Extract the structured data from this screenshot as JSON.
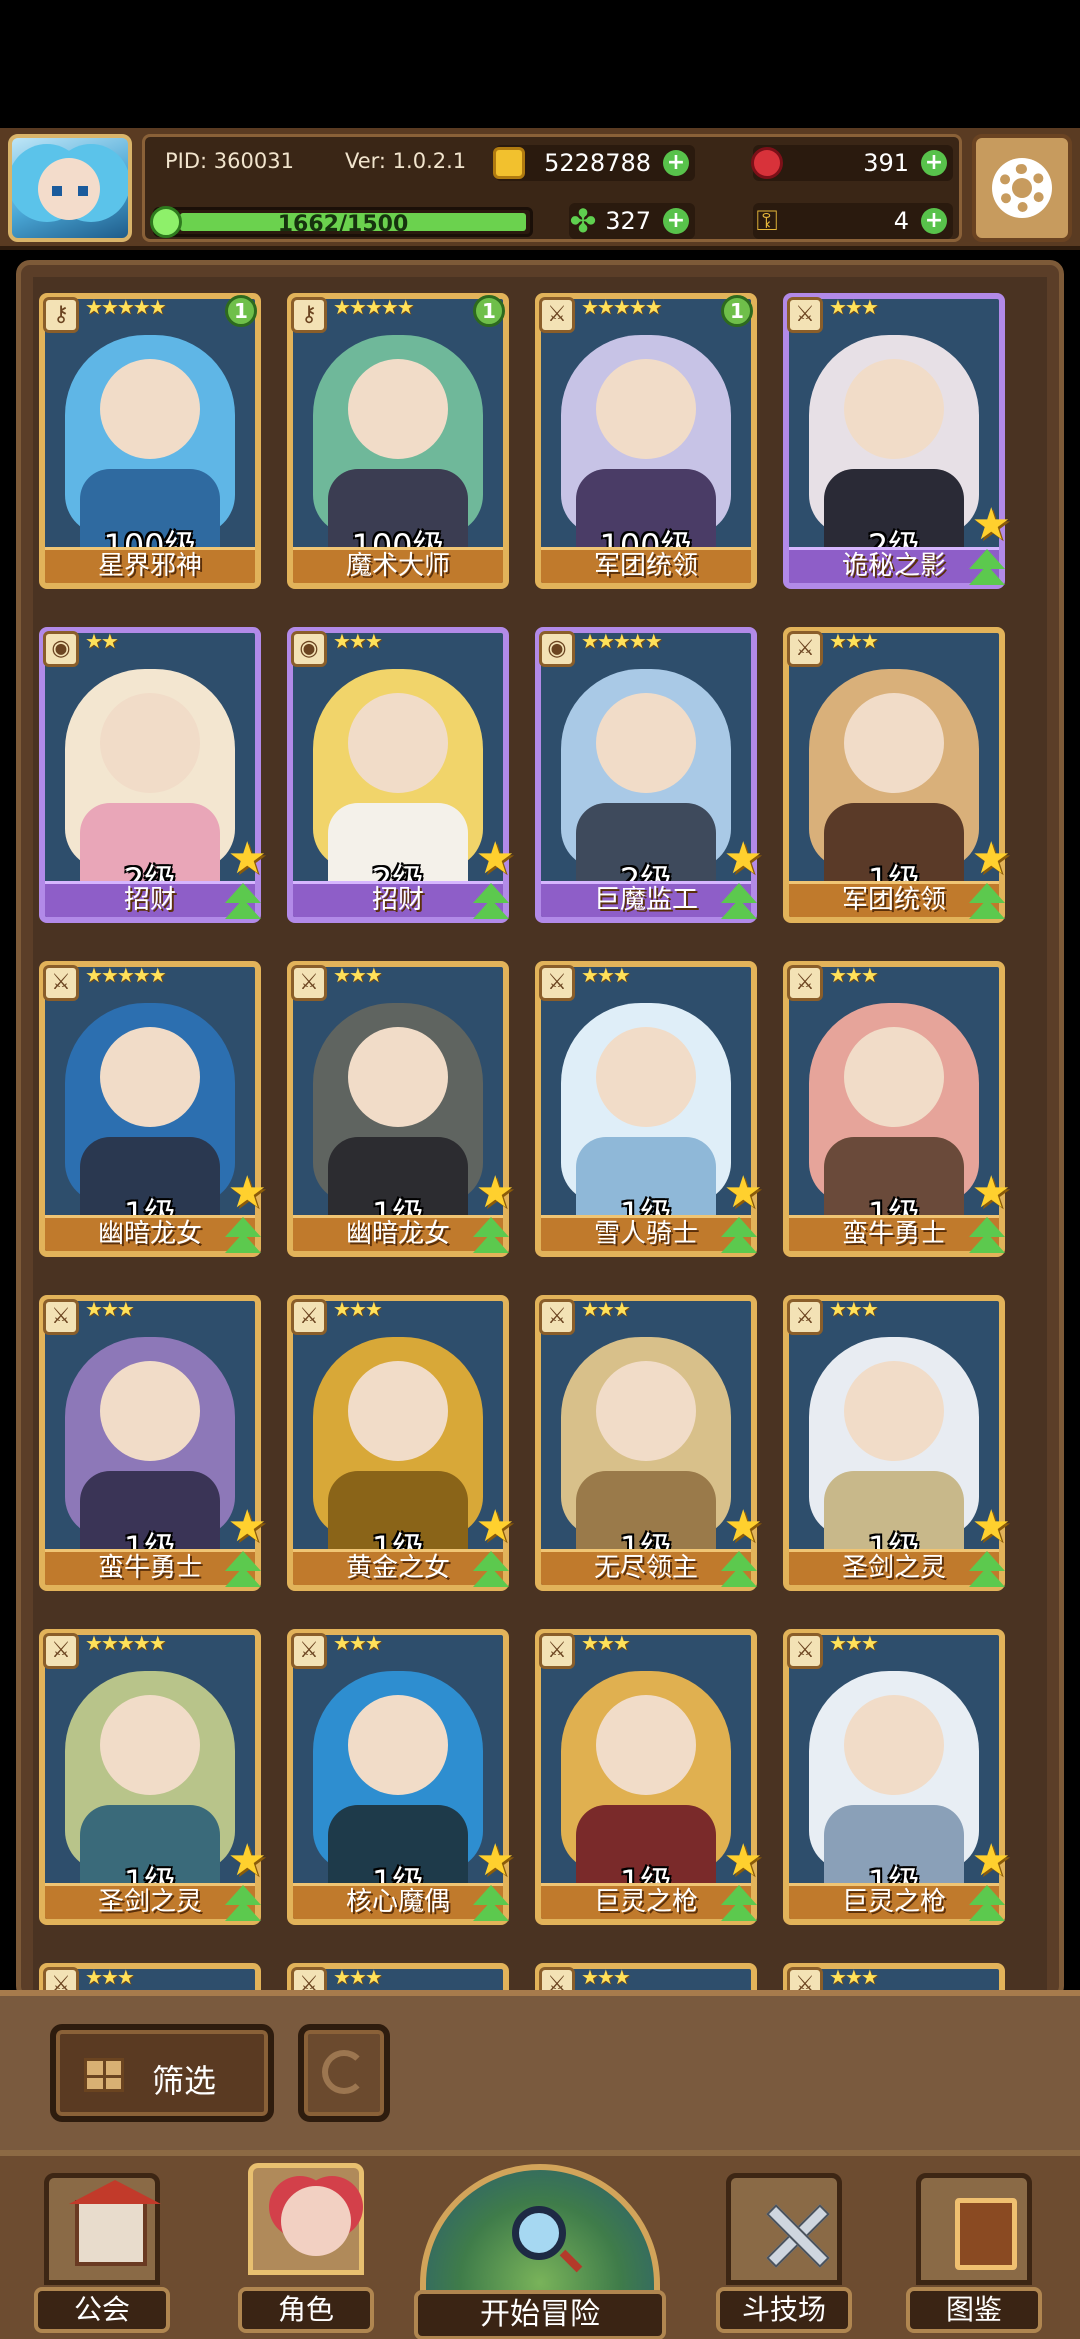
{
  "header": {
    "pid": "PID: 360031",
    "version": "Ver: 1.0.2.1",
    "gold": "5228788",
    "gems": "391",
    "clover": "327",
    "keys": "4",
    "exp_text": "1662/1500",
    "exp_progress": 1.0
  },
  "cards": [
    {
      "name": "星界邪神",
      "level": "100级",
      "stars": "★★★★★",
      "type": "key-icon",
      "badge": "1",
      "theme": "gold"
    },
    {
      "name": "魔术大师",
      "level": "100级",
      "stars": "★★★★★",
      "type": "key-icon",
      "badge": "1",
      "theme": "gold"
    },
    {
      "name": "军团统领",
      "level": "100级",
      "stars": "★★★★★",
      "type": "sword-icon",
      "badge": "1",
      "theme": "gold"
    },
    {
      "name": "诡秘之影",
      "level": "2级",
      "stars": "★★★",
      "type": "dagger-icon",
      "badge": "",
      "theme": "purple"
    },
    {
      "name": "招财",
      "level": "2级",
      "stars": "★★",
      "type": "coin-icon",
      "badge": "",
      "theme": "purple"
    },
    {
      "name": "招财",
      "level": "2级",
      "stars": "★★★",
      "type": "coin-icon",
      "badge": "",
      "theme": "purple"
    },
    {
      "name": "巨魔监工",
      "level": "2级",
      "stars": "★★★★★",
      "type": "coin-icon",
      "badge": "",
      "theme": "purple"
    },
    {
      "name": "军团统领",
      "level": "1级",
      "stars": "★★★",
      "type": "sword-icon",
      "badge": "",
      "theme": "gold"
    },
    {
      "name": "幽暗龙女",
      "level": "1级",
      "stars": "★★★★★",
      "type": "sword-icon",
      "badge": "",
      "theme": "gold"
    },
    {
      "name": "幽暗龙女",
      "level": "1级",
      "stars": "★★★",
      "type": "sword-icon",
      "badge": "",
      "theme": "gold"
    },
    {
      "name": "雪人骑士",
      "level": "1级",
      "stars": "★★★",
      "type": "sword-icon",
      "badge": "",
      "theme": "gold"
    },
    {
      "name": "蛮牛勇士",
      "level": "1级",
      "stars": "★★★",
      "type": "sword-icon",
      "badge": "",
      "theme": "gold"
    },
    {
      "name": "蛮牛勇士",
      "level": "1级",
      "stars": "★★★",
      "type": "sword-icon",
      "badge": "",
      "theme": "gold"
    },
    {
      "name": "黄金之女",
      "level": "1级",
      "stars": "★★★",
      "type": "sword-icon",
      "badge": "",
      "theme": "gold"
    },
    {
      "name": "无尽领主",
      "level": "1级",
      "stars": "★★★",
      "type": "sword-icon",
      "badge": "",
      "theme": "gold"
    },
    {
      "name": "圣剑之灵",
      "level": "1级",
      "stars": "★★★",
      "type": "sword-icon",
      "badge": "",
      "theme": "gold"
    },
    {
      "name": "圣剑之灵",
      "level": "1级",
      "stars": "★★★★★",
      "type": "sword-icon",
      "badge": "",
      "theme": "gold"
    },
    {
      "name": "核心魔偶",
      "level": "1级",
      "stars": "★★★",
      "type": "sword-icon",
      "badge": "",
      "theme": "gold"
    },
    {
      "name": "巨灵之枪",
      "level": "1级",
      "stars": "★★★",
      "type": "sword-icon",
      "badge": "",
      "theme": "gold"
    },
    {
      "name": "巨灵之枪",
      "level": "1级",
      "stars": "★★★",
      "type": "sword-icon",
      "badge": "",
      "theme": "gold"
    }
  ],
  "partial_row_stars": [
    "★★★",
    "★★★",
    "★★★",
    "★★★"
  ],
  "controls": {
    "filter_label": "筛选"
  },
  "nav": {
    "guild": "公会",
    "character": "角色",
    "start": "开始冒险",
    "arena": "斗技场",
    "codex": "图鉴"
  }
}
